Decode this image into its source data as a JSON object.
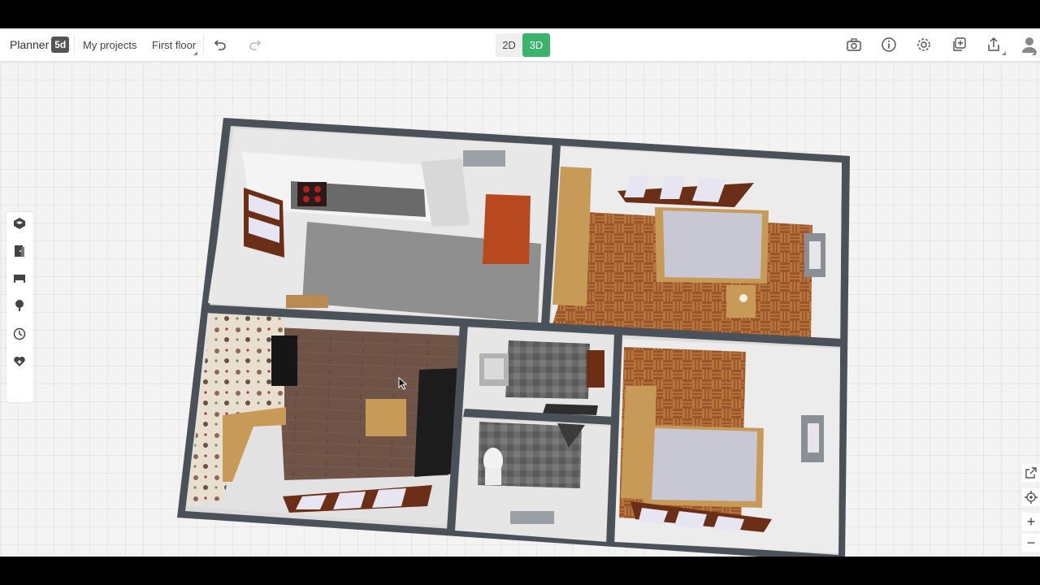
{
  "app": {
    "logo_text": "Planner",
    "logo_badge": "5d"
  },
  "toolbar": {
    "my_projects": "My projects",
    "floor_name": "First floor",
    "undo_icon": "undo-icon",
    "redo_icon": "redo-icon",
    "mode_2d": "2D",
    "mode_3d": "3D",
    "active_mode": "3D",
    "right_icons": [
      "camera-icon",
      "info-icon",
      "settings-icon",
      "duplicate-icon",
      "share-icon",
      "user-icon"
    ]
  },
  "sidebar": {
    "items": [
      "construction-icon",
      "doors-windows-icon",
      "furniture-icon",
      "plants-icon",
      "history-icon",
      "favorites-icon"
    ]
  },
  "view_controls": {
    "items": [
      "expand-icon",
      "locate-icon",
      "zoom-in-icon",
      "zoom-out-icon"
    ],
    "zoom_in_label": "+",
    "zoom_out_label": "−"
  },
  "colors": {
    "accent_green": "#3bb36a",
    "wall": "#4a5058",
    "parquet": "#9c5a2c",
    "wood_floor": "#6e5246"
  }
}
